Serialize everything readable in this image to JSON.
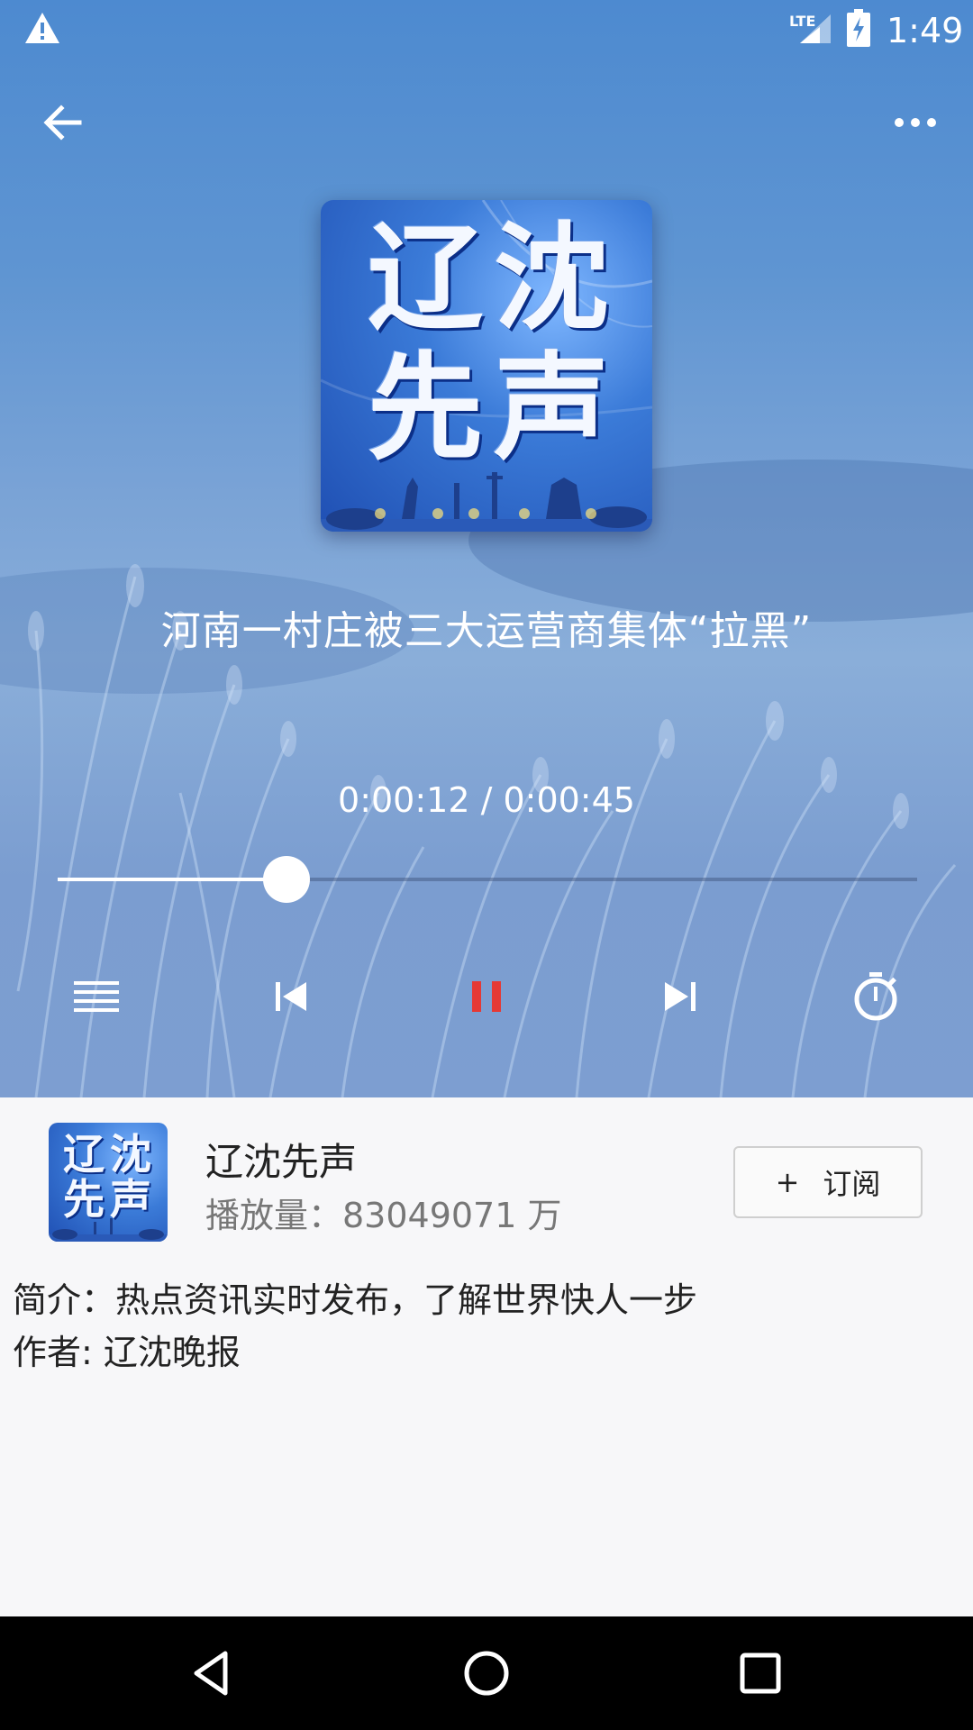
{
  "status_bar": {
    "network": "LTE",
    "time": "1:49",
    "icons": [
      "warning-icon",
      "signal-icon",
      "battery-charging-icon"
    ]
  },
  "header": {
    "back_icon": "arrow-left-icon",
    "more_icon": "more-horizontal-icon"
  },
  "cover": {
    "chars": [
      "辽",
      "沈",
      "先",
      "声"
    ]
  },
  "episode": {
    "title": "河南一村庄被三大运营商集体“拉黑”"
  },
  "playback": {
    "time_display": "0:00:12 / 0:00:45",
    "progress": 0.2667,
    "state": "playing"
  },
  "controls": [
    {
      "name": "playlist-icon"
    },
    {
      "name": "previous-icon"
    },
    {
      "name": "pause-icon"
    },
    {
      "name": "next-icon"
    },
    {
      "name": "timer-icon"
    }
  ],
  "channel": {
    "name": "辽沈先声",
    "plays": "播放量：83049071 万",
    "subscribe_plus": "+",
    "subscribe_label": "订阅",
    "description": "简介：热点资讯实时发布，了解世界快人一步",
    "author": "作者: 辽沈晚报"
  },
  "colors": {
    "accent": "#e53935",
    "player_bg": "#6b9bd4"
  },
  "nav_bar": {
    "icons": [
      "nav-back-icon",
      "nav-home-icon",
      "nav-recents-icon"
    ]
  }
}
